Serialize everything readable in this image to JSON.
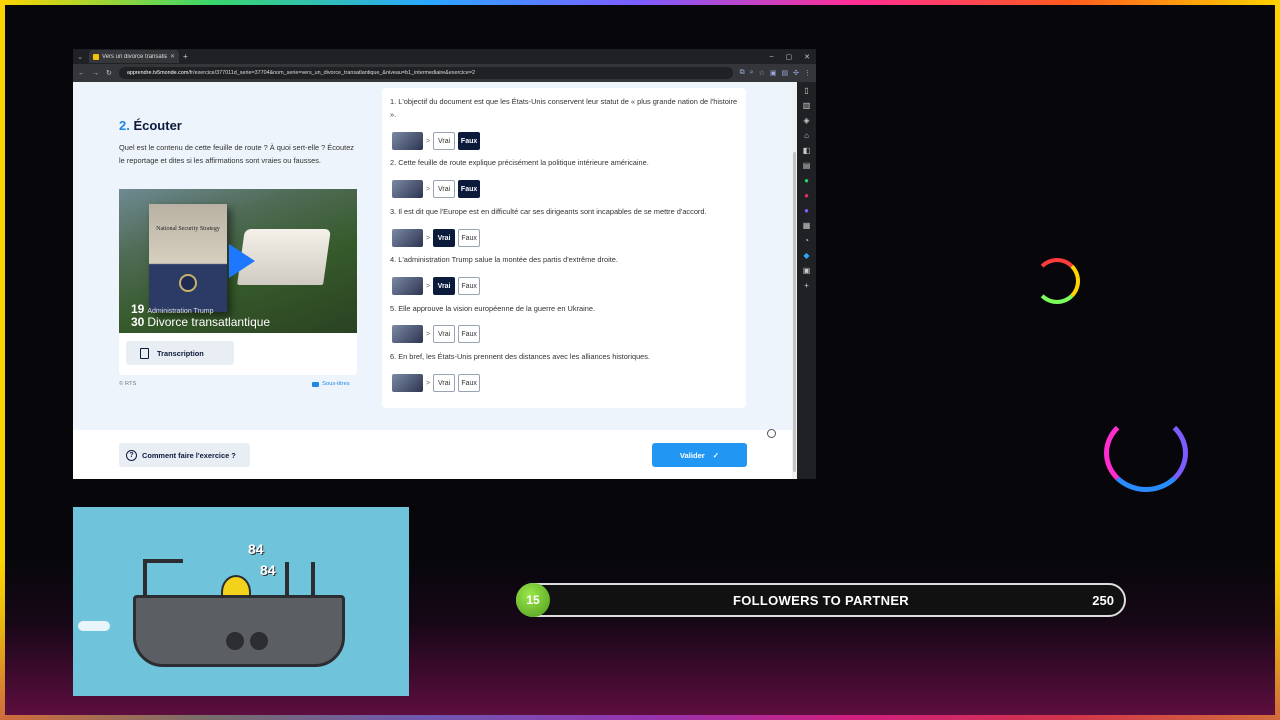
{
  "browser": {
    "tab_title": "Vers un divorce transatlantique",
    "url_host": "apprendre.tv5monde.com",
    "url_path": "/fr/exercice/377011d_serie=37704&nom_serie=vers_un_divorce_transatlantique_&niveau=b1_intermediaire&exercice=2"
  },
  "section": {
    "number": "2.",
    "title": "Écouter",
    "intro": "Quel est le contenu de cette feuille de route ? À quoi sert-elle ? Écoutez le reportage et dites si les affirmations sont vraies ou fausses."
  },
  "video": {
    "book_title": "National Security Strategy",
    "kicker_num": "19",
    "kicker_text": "Administration Trump",
    "headline_num": "30",
    "headline_text": "Divorce transatlantique",
    "transcript_label": "Transcription",
    "credit": "© RTS",
    "subtitles_label": "Sous-titres"
  },
  "options": {
    "true_label": "Vrai",
    "false_label": "Faux"
  },
  "questions": [
    {
      "text": "1. L'objectif du document est que les États-Unis conservent leur statut de « plus grande nation de l'histoire ».",
      "selected": "Faux"
    },
    {
      "text": "2. Cette feuille de route explique précisément la politique intérieure américaine.",
      "selected": "Faux"
    },
    {
      "text": "3. Il est dit que l'Europe est en difficulté car ses dirigeants sont incapables de se mettre d'accord.",
      "selected": "Vrai"
    },
    {
      "text": "4. L'administration Trump salue la montée des partis d'extrême droite.",
      "selected": "Vrai"
    },
    {
      "text": "5. Elle approuve la vision européenne de la guerre en Ukraine.",
      "selected": null
    },
    {
      "text": "6. En bref, les États-Unis prennent des distances avec les alliances historiques.",
      "selected": null
    }
  ],
  "footer": {
    "help_label": "Comment faire l'exercice ?",
    "submit_label": "Valider"
  },
  "game": {
    "damage_1": "84",
    "damage_2": "84"
  },
  "followers": {
    "current": "15",
    "label": "FOLLOWERS TO PARTNER",
    "goal": "250"
  }
}
